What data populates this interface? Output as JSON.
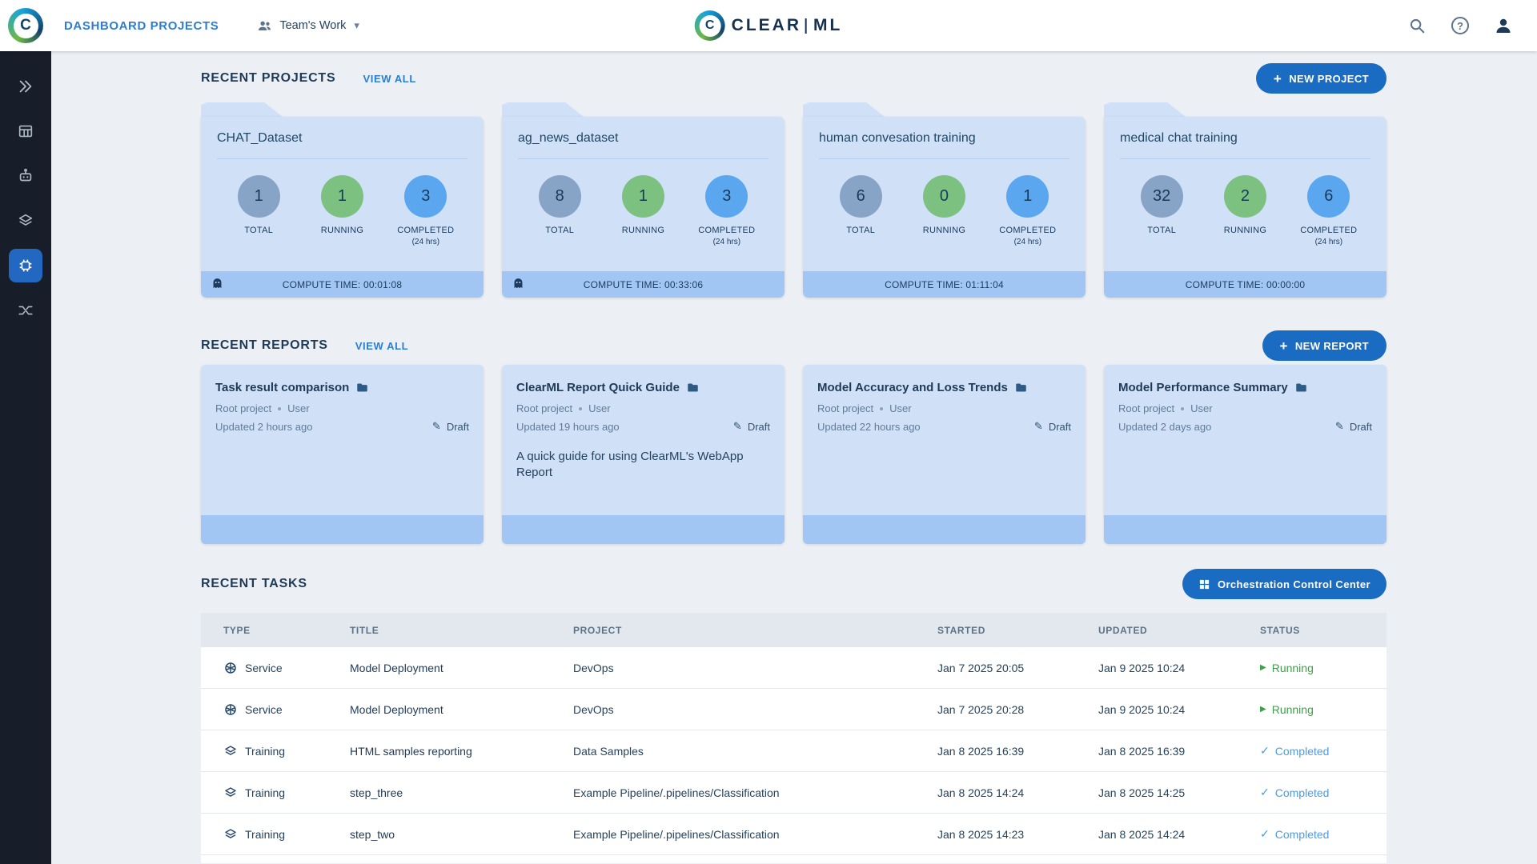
{
  "header": {
    "nav_title": "DASHBOARD PROJECTS",
    "workspace_label": "Team's Work",
    "logo_left": "CLEAR",
    "logo_right": "ML"
  },
  "glyphs": {
    "logo_letter": "C",
    "plus": "+",
    "caret_down": "▾",
    "question": "?",
    "pencil": "✎",
    "play": "▶",
    "check": "✓"
  },
  "sidebar": {
    "items": [
      {
        "name": "projects"
      },
      {
        "name": "datasets"
      },
      {
        "name": "pipelines"
      },
      {
        "name": "hyper-datasets"
      },
      {
        "name": "applications",
        "selected": true
      },
      {
        "name": "orchestration"
      }
    ]
  },
  "projects_section": {
    "title": "RECENT PROJECTS",
    "view_all": "VIEW ALL",
    "new_button": "NEW PROJECT",
    "stat_labels": {
      "total": "TOTAL",
      "running": "RUNNING",
      "completed": "COMPLETED",
      "completed_sub": "(24 hrs)"
    },
    "cards": [
      {
        "name": "CHAT_Dataset",
        "total": "1",
        "running": "1",
        "completed": "3",
        "compute_time": "COMPUTE TIME: 00:01:08"
      },
      {
        "name": "ag_news_dataset",
        "total": "8",
        "running": "1",
        "completed": "3",
        "compute_time": "COMPUTE TIME: 00:33:06"
      },
      {
        "name": "human convesation training",
        "total": "6",
        "running": "0",
        "completed": "1",
        "compute_time": "COMPUTE TIME: 01:11:04"
      },
      {
        "name": "medical chat training",
        "total": "32",
        "running": "2",
        "completed": "6",
        "compute_time": "COMPUTE TIME: 00:00:00"
      }
    ]
  },
  "reports_section": {
    "title": "RECENT REPORTS",
    "view_all": "VIEW ALL",
    "new_button": "NEW REPORT",
    "cards": [
      {
        "name": "Task result comparison",
        "project": "Root project",
        "author": "User",
        "updated": "Updated 2 hours ago",
        "status": "Draft",
        "description": ""
      },
      {
        "name": "ClearML Report Quick Guide",
        "project": "Root project",
        "author": "User",
        "updated": "Updated 19 hours ago",
        "status": "Draft",
        "description": "A quick guide for using ClearML's WebApp Report"
      },
      {
        "name": "Model Accuracy and Loss Trends",
        "project": "Root project",
        "author": "User",
        "updated": "Updated 22 hours ago",
        "status": "Draft",
        "description": ""
      },
      {
        "name": "Model Performance Summary",
        "project": "Root project",
        "author": "User",
        "updated": "Updated 2 days ago",
        "status": "Draft",
        "description": ""
      }
    ]
  },
  "tasks_section": {
    "title": "RECENT TASKS",
    "orchestration_button": "Orchestration Control Center",
    "columns": {
      "type": "TYPE",
      "title": "TITLE",
      "project": "PROJECT",
      "started": "STARTED",
      "updated": "UPDATED",
      "status": "STATUS"
    },
    "rows": [
      {
        "type": "Service",
        "title": "Model Deployment",
        "project": "DevOps",
        "started": "Jan 7 2025 20:05",
        "updated": "Jan 9 2025 10:24",
        "status": "Running"
      },
      {
        "type": "Service",
        "title": "Model Deployment",
        "project": "DevOps",
        "started": "Jan 7 2025 20:28",
        "updated": "Jan 9 2025 10:24",
        "status": "Running"
      },
      {
        "type": "Training",
        "title": "HTML samples reporting",
        "project": "Data Samples",
        "started": "Jan 8 2025 16:39",
        "updated": "Jan 8 2025 16:39",
        "status": "Completed"
      },
      {
        "type": "Training",
        "title": "step_three",
        "project": "Example Pipeline/.pipelines/Classification",
        "started": "Jan 8 2025 14:24",
        "updated": "Jan 8 2025 14:25",
        "status": "Completed"
      },
      {
        "type": "Training",
        "title": "step_two",
        "project": "Example Pipeline/.pipelines/Classification",
        "started": "Jan 8 2025 14:23",
        "updated": "Jan 8 2025 14:24",
        "status": "Completed"
      }
    ]
  },
  "colors": {
    "accent_blue": "#1a6cc2",
    "link_blue": "#2d7dd2",
    "page_bg": "#ecf0f5",
    "sidebar_bg": "#181e29",
    "sidebar_selected": "#2368c0",
    "card_bg": "#cfe0f7",
    "card_footer": "#a2c6f3",
    "circle_total": "#87a3c6",
    "circle_running": "#7cc180",
    "circle_completed": "#5ba7ef",
    "status_running": "#3aa148",
    "status_completed": "#4d9be6",
    "text_navy": "#1f3a57"
  }
}
